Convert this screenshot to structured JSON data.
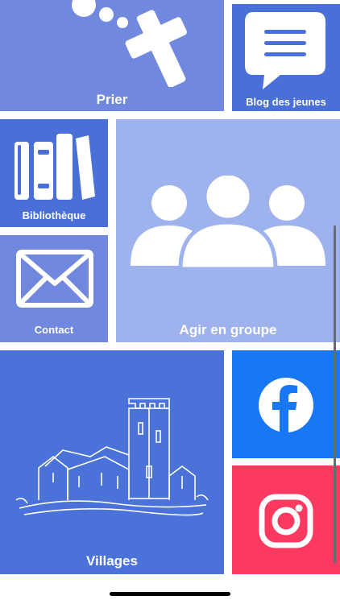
{
  "tiles": {
    "prier": {
      "label": "Prier"
    },
    "blog": {
      "label": "Blog des jeunes"
    },
    "bibliotheque": {
      "label": "Bibliothèque"
    },
    "contact": {
      "label": "Contact"
    },
    "agir": {
      "label": "Agir en groupe"
    },
    "villages": {
      "label": "Villages"
    },
    "facebook": {
      "icon": "facebook-icon"
    },
    "instagram": {
      "icon": "instagram-icon"
    }
  },
  "icons": {
    "prier": "cross-icon",
    "blog": "chat-bubble-icon",
    "bibliotheque": "books-icon",
    "contact": "envelope-icon",
    "agir": "group-icon",
    "villages": "church-icon"
  },
  "colors": {
    "tile_light": "#7088dd",
    "tile_dark": "#4a6fd6",
    "tile_pale": "#9eb2ee",
    "facebook": "#1877f2",
    "instagram": "#fc3a5f"
  }
}
